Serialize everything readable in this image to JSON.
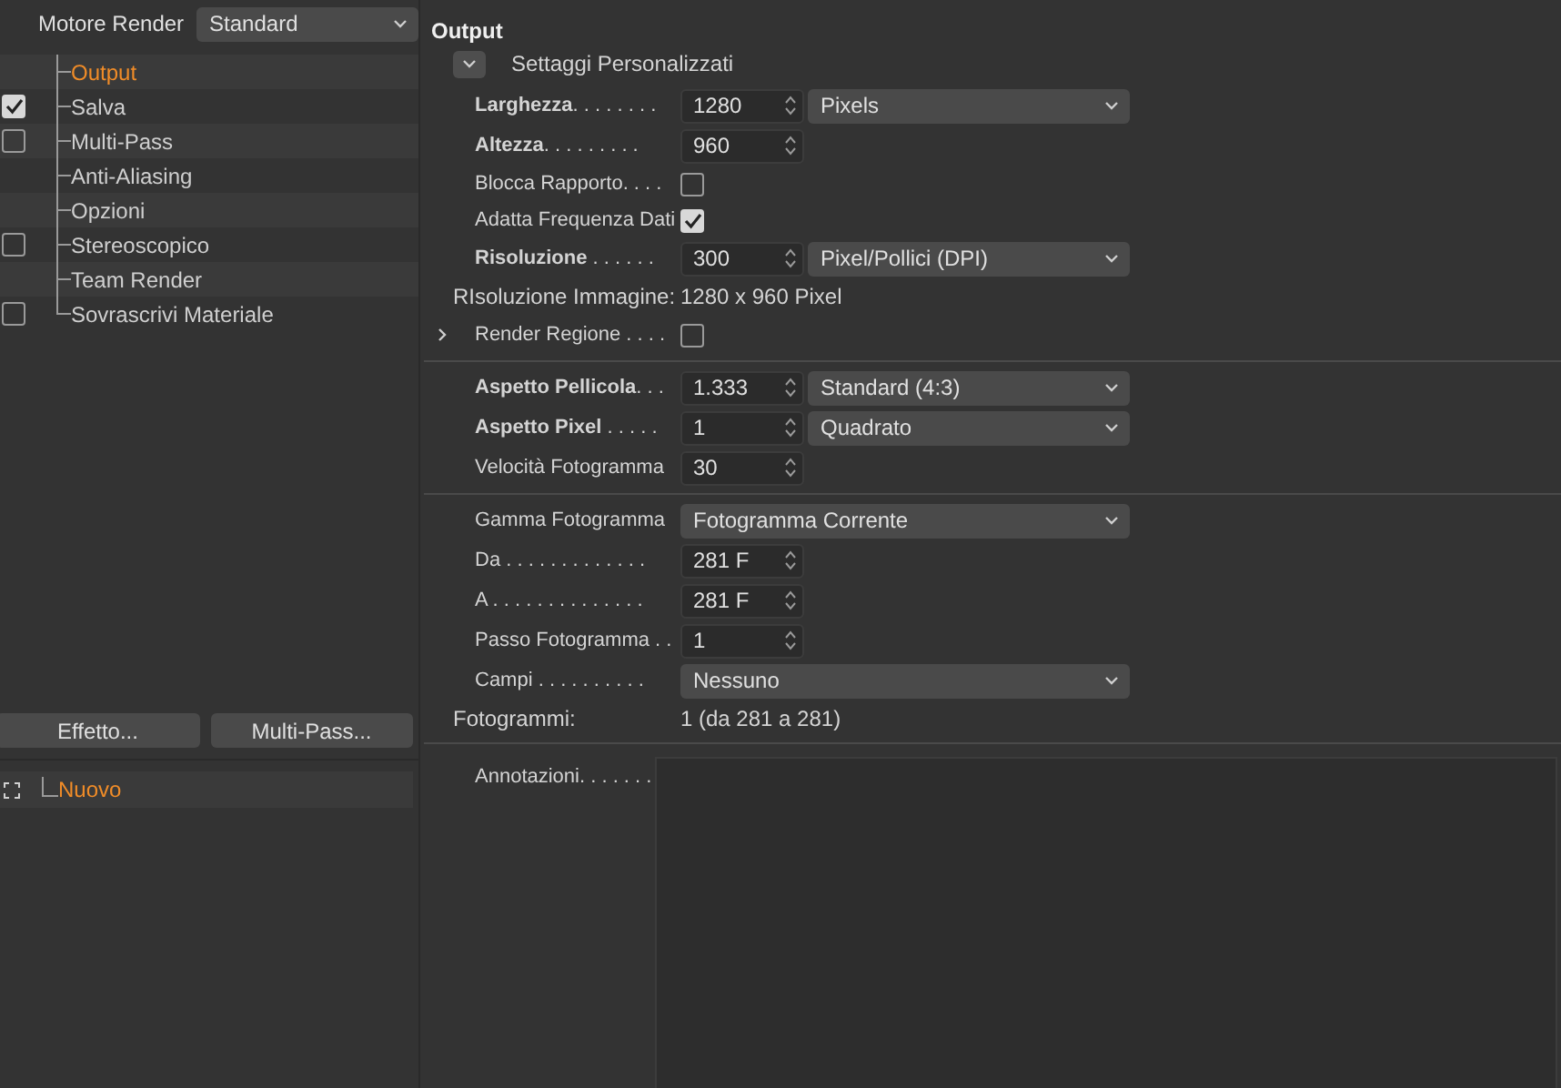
{
  "render_engine": {
    "label": "Motore Render",
    "value": "Standard"
  },
  "tree": [
    {
      "label": "Output",
      "selected": true
    },
    {
      "label": "Salva",
      "selected": false,
      "checked": true
    },
    {
      "label": "Multi-Pass",
      "selected": false,
      "checked": false
    },
    {
      "label": "Anti-Aliasing",
      "selected": false
    },
    {
      "label": "Opzioni",
      "selected": false
    },
    {
      "label": "Stereoscopico",
      "selected": false,
      "checked": false
    },
    {
      "label": "Team Render",
      "selected": false
    },
    {
      "label": "Sovrascrivi Materiale",
      "selected": false,
      "checked": false
    }
  ],
  "buttons": [
    "Effetto...",
    "Multi-Pass..."
  ],
  "effects": [
    {
      "label": "Nuovo",
      "selected": true
    }
  ],
  "panel": {
    "title": "Output",
    "preset": {
      "label": "Settaggi Personalizzati",
      "expanded": true
    },
    "sections": [
      [
        {
          "kind": "number",
          "label": "**Larghezza**. . . . . . . .",
          "value": "1280",
          "unit": "Pixels"
        },
        {
          "kind": "number",
          "label": "**Altezza**. . . . . . . . .",
          "value": "960"
        },
        {
          "kind": "checkbox",
          "label": "Blocca Rapporto. . . .",
          "checked": false
        },
        {
          "kind": "checkbox",
          "label": "Adatta Frequenza Dati",
          "checked": true
        },
        {
          "kind": "number",
          "label": "**Risoluzione** . . . . . .",
          "value": "300",
          "unit": "Pixel/Pollici (DPI)"
        },
        {
          "kind": "info",
          "label": "RIsoluzione Immagine:",
          "value": "1280 x 960 Pixel"
        },
        {
          "kind": "expander",
          "label": "Render Regione . . . .",
          "checked": false,
          "expanded": false
        }
      ],
      [
        {
          "kind": "number",
          "label": "**Aspetto Pellicola**. . .",
          "value": "1.333",
          "unit": "Standard (4:3)"
        },
        {
          "kind": "number",
          "label": "**Aspetto Pixel** . . . . .",
          "value": "1",
          "unit": "Quadrato"
        },
        {
          "kind": "number",
          "label": "Velocità Fotogramma",
          "value": "30"
        }
      ],
      [
        {
          "kind": "select",
          "label": "Gamma Fotogramma",
          "value": "Fotogramma Corrente"
        },
        {
          "kind": "number",
          "label": "Da . . . . . . . . . . . . .",
          "value": "281 F"
        },
        {
          "kind": "number",
          "label": "A . . . . . . . . . . . . . .",
          "value": "281 F"
        },
        {
          "kind": "number",
          "label": "Passo Fotogramma . .",
          "value": "1"
        },
        {
          "kind": "select",
          "label": "Campi . . . . . . . . . .",
          "value": "Nessuno"
        },
        {
          "kind": "info",
          "label": "Fotogrammi:",
          "value": "1 (da 281 a 281)"
        }
      ],
      [
        {
          "kind": "textarea",
          "label": "Annotazioni. . . . . . ."
        }
      ]
    ]
  }
}
